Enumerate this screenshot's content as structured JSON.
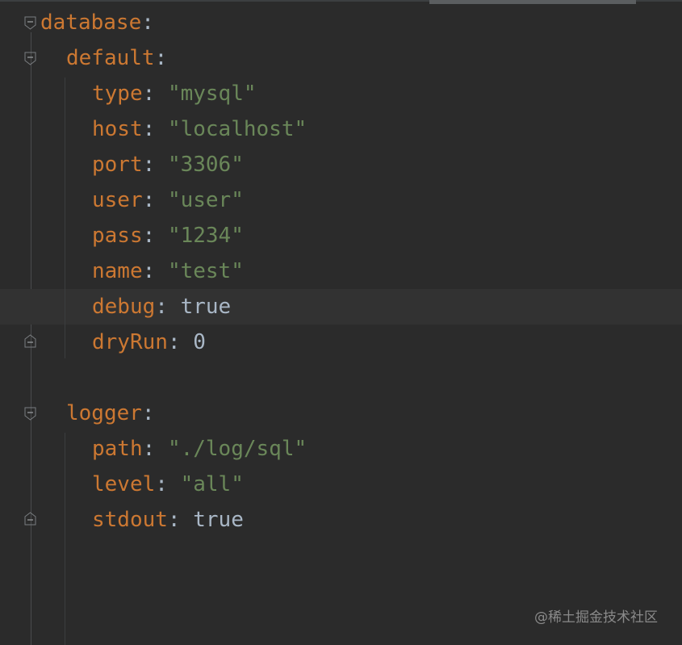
{
  "lines": [
    {
      "key": "database",
      "colon": ":",
      "value": "",
      "value_type": "none"
    },
    {
      "key": "default",
      "colon": ":",
      "value": "",
      "value_type": "none"
    },
    {
      "key": "type",
      "colon": ": ",
      "value": "\"mysql\"",
      "value_type": "string"
    },
    {
      "key": "host",
      "colon": ": ",
      "value": "\"localhost\"",
      "value_type": "string"
    },
    {
      "key": "port",
      "colon": ": ",
      "value": "\"3306\"",
      "value_type": "string"
    },
    {
      "key": "user",
      "colon": ": ",
      "value": "\"user\"",
      "value_type": "string"
    },
    {
      "key": "pass",
      "colon": ": ",
      "value": "\"1234\"",
      "value_type": "string"
    },
    {
      "key": "name",
      "colon": ": ",
      "value": "\"test\"",
      "value_type": "string"
    },
    {
      "key": "debug",
      "colon": ": ",
      "value": "true",
      "value_type": "literal"
    },
    {
      "key": "dryRun",
      "colon": ": ",
      "value": "0",
      "value_type": "literal"
    },
    {
      "key": "logger",
      "colon": ":",
      "value": "",
      "value_type": "none"
    },
    {
      "key": "path",
      "colon": ": ",
      "value": "\"./log/sql\"",
      "value_type": "string"
    },
    {
      "key": "level",
      "colon": ": ",
      "value": "\"all\"",
      "value_type": "string"
    },
    {
      "key": "stdout",
      "colon": ": ",
      "value": "true",
      "value_type": "literal"
    }
  ],
  "watermark": "@稀土掘金技术社区",
  "colors": {
    "background": "#2b2b2b",
    "key": "#cc7832",
    "string": "#6a8759",
    "literal": "#a9b7c6",
    "current_line": "#323232"
  },
  "icons": {
    "fold_open": "fold-open-icon",
    "fold_end": "fold-end-icon"
  }
}
